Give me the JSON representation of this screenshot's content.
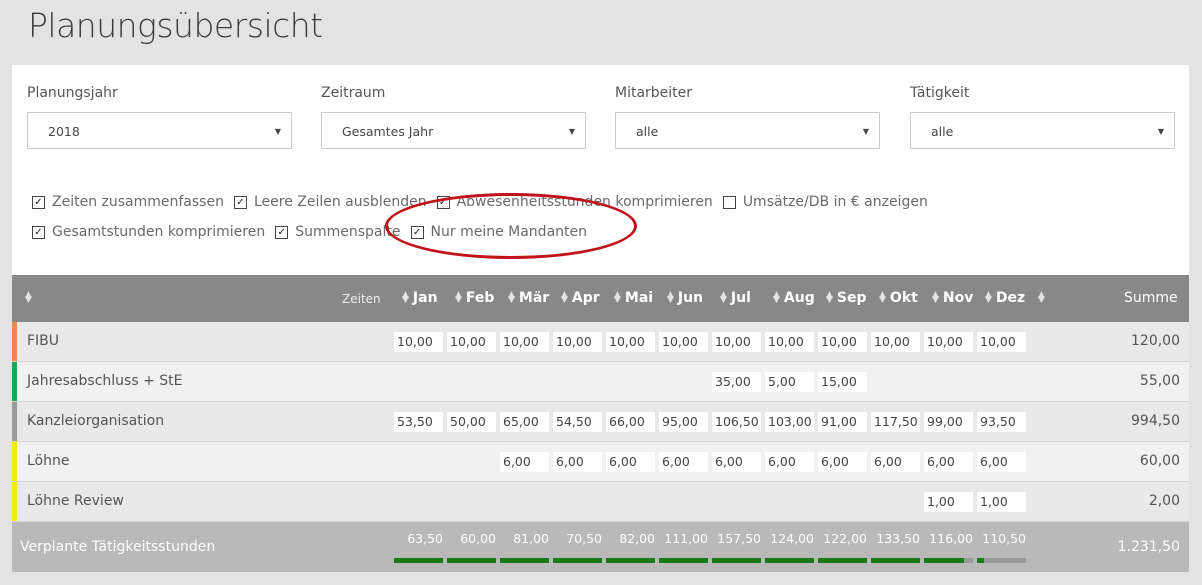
{
  "page": {
    "title": "Planungsübersicht"
  },
  "filters": [
    {
      "label": "Planungsjahr",
      "value": "2018"
    },
    {
      "label": "Zeitraum",
      "value": "Gesamtes Jahr"
    },
    {
      "label": "Mitarbeiter",
      "value": "alle"
    },
    {
      "label": "Tätigkeit",
      "value": "alle"
    }
  ],
  "options": [
    {
      "label": "Zeiten zusammenfassen",
      "checked": true
    },
    {
      "label": "Leere Zeilen ausblenden",
      "checked": true
    },
    {
      "label": "Abwesenheitsstunden komprimieren",
      "checked": true
    },
    {
      "label": "Umsätze/DB in € anzeigen",
      "checked": false
    },
    {
      "label": "Gesamtstunden komprimieren",
      "checked": true
    },
    {
      "label": "Summenspalte",
      "checked": true
    },
    {
      "label": "Nur meine Mandanten",
      "checked": true
    }
  ],
  "table": {
    "zeiten_label": "Zeiten",
    "months": [
      "Jan",
      "Feb",
      "Mär",
      "Apr",
      "Mai",
      "Jun",
      "Jul",
      "Aug",
      "Sep",
      "Okt",
      "Nov",
      "Dez"
    ],
    "summe_label": "Summe",
    "rows": [
      {
        "name": "FIBU",
        "color": "#f0894d",
        "values": [
          "10,00",
          "10,00",
          "10,00",
          "10,00",
          "10,00",
          "10,00",
          "10,00",
          "10,00",
          "10,00",
          "10,00",
          "10,00",
          "10,00"
        ],
        "sum": "120,00"
      },
      {
        "name": "Jahresabschluss + StE",
        "color": "#1aa65a",
        "values": [
          "",
          "",
          "",
          "",
          "",
          "",
          "35,00",
          "5,00",
          "15,00",
          "",
          "",
          ""
        ],
        "sum": "55,00"
      },
      {
        "name": "Kanzleiorganisation",
        "color": "#9a9a9a",
        "values": [
          "53,50",
          "50,00",
          "65,00",
          "54,50",
          "66,00",
          "95,00",
          "106,50",
          "103,00",
          "91,00",
          "117,50",
          "99,00",
          "93,50"
        ],
        "sum": "994,50"
      },
      {
        "name": "Löhne",
        "color": "#f2ea18",
        "values": [
          "",
          "",
          "6,00",
          "6,00",
          "6,00",
          "6,00",
          "6,00",
          "6,00",
          "6,00",
          "6,00",
          "6,00",
          "6,00"
        ],
        "sum": "60,00"
      },
      {
        "name": "Löhne Review",
        "color": "#f2ea18",
        "values": [
          "",
          "",
          "",
          "",
          "",
          "",
          "",
          "",
          "",
          "",
          "1,00",
          "1,00"
        ],
        "sum": "2,00"
      }
    ],
    "footer": {
      "label": "Verplante Tätigkeitsstunden",
      "totals": [
        "63,50",
        "60,00",
        "81,00",
        "70,50",
        "82,00",
        "111,00",
        "157,50",
        "124,00",
        "122,00",
        "133,50",
        "116,00",
        "110,50"
      ],
      "utilization": [
        1,
        1,
        1,
        1,
        1,
        1,
        1,
        1,
        1,
        1,
        0.82,
        0.15
      ],
      "sum": "1.231,50"
    }
  }
}
